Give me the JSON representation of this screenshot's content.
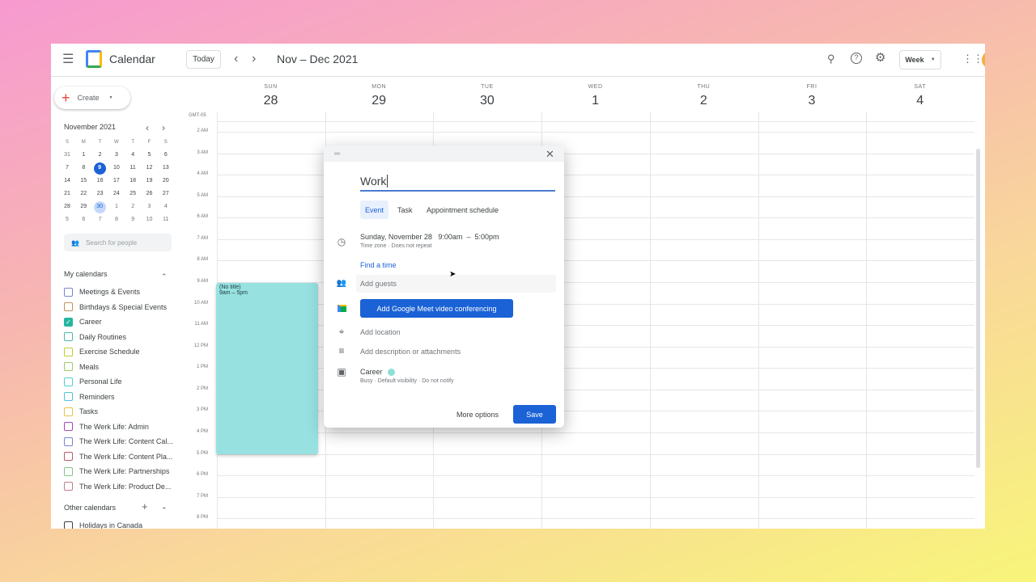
{
  "header": {
    "app_name": "Calendar",
    "today": "Today",
    "date_range": "Nov – Dec 2021",
    "view": "Week",
    "icons": [
      "menu-icon",
      "calendar-logo",
      "chevron-left-icon",
      "chevron-right-icon",
      "search-icon",
      "help-icon",
      "settings-icon",
      "apps-grid-icon"
    ]
  },
  "sidebar": {
    "create": "Create",
    "mini_calendar": {
      "title": "November 2021",
      "weekdays": [
        "S",
        "M",
        "T",
        "W",
        "T",
        "F",
        "S"
      ],
      "weeks": [
        [
          "31",
          "1",
          "2",
          "3",
          "4",
          "5",
          "6"
        ],
        [
          "7",
          "8",
          "9",
          "10",
          "11",
          "12",
          "13"
        ],
        [
          "14",
          "15",
          "16",
          "17",
          "18",
          "19",
          "20"
        ],
        [
          "21",
          "22",
          "23",
          "24",
          "25",
          "26",
          "27"
        ],
        [
          "28",
          "29",
          "30",
          "1",
          "2",
          "3",
          "4"
        ],
        [
          "5",
          "6",
          "7",
          "8",
          "9",
          "10",
          "11"
        ]
      ],
      "today": "9",
      "selected": "30"
    },
    "search_people": "Search for people",
    "my_calendars_title": "My calendars",
    "my_calendars": [
      {
        "label": "Meetings & Events",
        "color": "#7986cb",
        "checked": false
      },
      {
        "label": "Birthdays & Special Events",
        "color": "#c0915a",
        "checked": false
      },
      {
        "label": "Career",
        "color": "#26b5a0",
        "checked": true
      },
      {
        "label": "Daily Routines",
        "color": "#4db6ac",
        "checked": false
      },
      {
        "label": "Exercise Schedule",
        "color": "#c0ca33",
        "checked": false
      },
      {
        "label": "Meals",
        "color": "#9ccc65",
        "checked": false
      },
      {
        "label": "Personal Life",
        "color": "#4dd0d0",
        "checked": false
      },
      {
        "label": "Reminders",
        "color": "#4fc3d7",
        "checked": false
      },
      {
        "label": "Tasks",
        "color": "#e4c441",
        "checked": false
      },
      {
        "label": "The Werk Life: Admin",
        "color": "#ab47bc",
        "checked": false
      },
      {
        "label": "The Werk Life: Content Cal...",
        "color": "#7986cb",
        "checked": false
      },
      {
        "label": "The Werk Life: Content Pla...",
        "color": "#c2566b",
        "checked": false
      },
      {
        "label": "The Werk Life: Partnerships",
        "color": "#81c784",
        "checked": false
      },
      {
        "label": "The Werk Life: Product De...",
        "color": "#c27c8c",
        "checked": false
      }
    ],
    "other_calendars_title": "Other calendars",
    "other_calendars": [
      {
        "label": "Holidays in Canada",
        "color": "#3c4043",
        "checked": false
      }
    ]
  },
  "grid": {
    "timezone": "GMT-05",
    "days": [
      {
        "name": "SUN",
        "date": "28"
      },
      {
        "name": "MON",
        "date": "29"
      },
      {
        "name": "TUE",
        "date": "30"
      },
      {
        "name": "WED",
        "date": "1"
      },
      {
        "name": "THU",
        "date": "2"
      },
      {
        "name": "FRI",
        "date": "3"
      },
      {
        "name": "SAT",
        "date": "4"
      }
    ],
    "hours": [
      "2 AM",
      "3 AM",
      "4 AM",
      "5 AM",
      "6 AM",
      "7 AM",
      "8 AM",
      "9 AM",
      "10 AM",
      "11 AM",
      "12 PM",
      "1 PM",
      "2 PM",
      "3 PM",
      "4 PM",
      "5 PM",
      "6 PM",
      "7 PM",
      "8 PM"
    ],
    "event": {
      "title": "(No title)",
      "time": "9am – 5pm",
      "color": "#97e1e1"
    }
  },
  "dialog": {
    "title_value": "Work",
    "tabs": [
      "Event",
      "Task",
      "Appointment schedule"
    ],
    "active_tab": "Event",
    "date": "Sunday, November 28",
    "start": "9:00am",
    "dash": "–",
    "end": "5:00pm",
    "sub": "Time zone · Does not repeat",
    "find_time": "Find a time",
    "guests_placeholder": "Add guests",
    "meet": "Add Google Meet video conferencing",
    "location": "Add location",
    "description": "Add description or attachments",
    "calendar": "Career",
    "calendar_color": "#8fdfd6",
    "calendar_sub": "Busy · Default visibility · Do not notify",
    "more_options": "More options",
    "save": "Save",
    "accent": "#1a62d6"
  }
}
